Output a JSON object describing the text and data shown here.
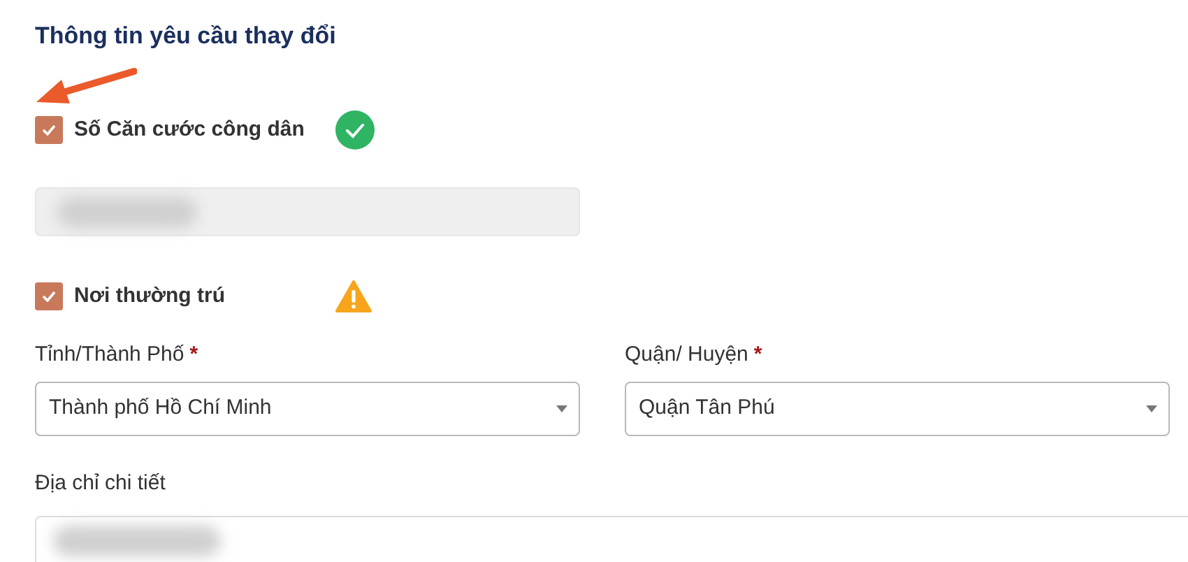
{
  "section_title": "Thông tin yêu cầu thay đổi",
  "annotation": {
    "kind": "arrow"
  },
  "id_change": {
    "label": "Số Căn cước công dân",
    "checked": true,
    "status": {
      "kind": "verified"
    },
    "field": {
      "disabled": true,
      "redacted": true
    }
  },
  "residence_change": {
    "label": "Nơi thường trú",
    "checked": true,
    "status": {
      "kind": "warning"
    }
  },
  "selects": [
    {
      "label": "Tỉnh/Thành Phố",
      "required_mark": "*",
      "value": "Thành phố Hồ Chí Minh"
    },
    {
      "label": "Quận/ Huyện",
      "required_mark": "*",
      "value": "Quận Tân Phú"
    }
  ],
  "address": {
    "label": "Địa chỉ chi tiết",
    "disabled": false,
    "redacted": true
  }
}
